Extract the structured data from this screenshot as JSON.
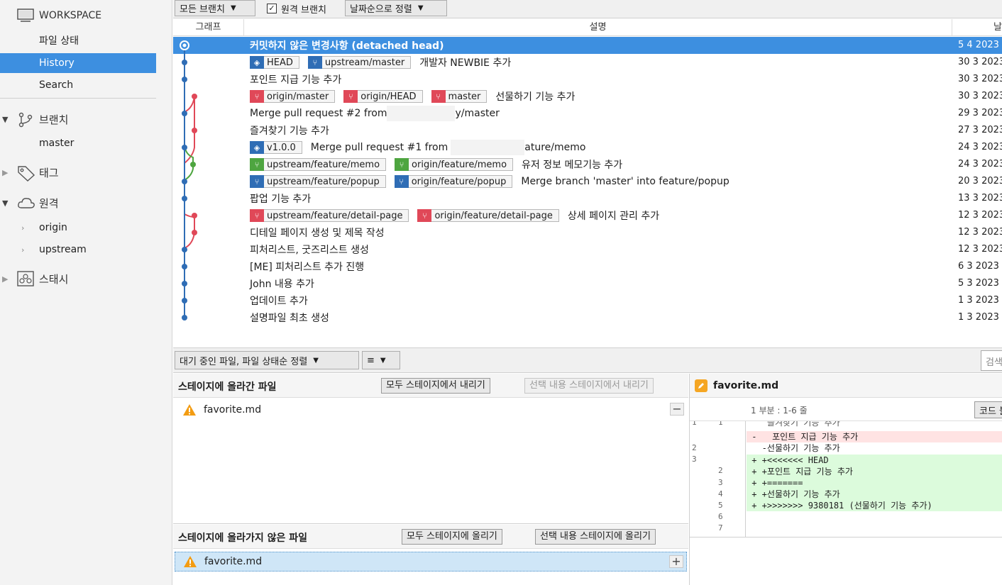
{
  "sidebar": {
    "workspace_label": "WORKSPACE",
    "workspace_items": [
      "파일 상태",
      "History",
      "Search"
    ],
    "branches_label": "브랜치",
    "branches": [
      "master"
    ],
    "tags_label": "태그",
    "remotes_label": "원격",
    "remotes": [
      "origin",
      "upstream"
    ],
    "stash_label": "스태시"
  },
  "toolbar": {
    "branch_filter": "모든 브랜치",
    "remote_branches_label": "원격 브랜치",
    "remote_branches_checked": true,
    "sort_label": "날짜순으로 정렬"
  },
  "table": {
    "col_graph": "그래프",
    "col_desc": "설명",
    "col_date": "날",
    "rows": [
      {
        "desc": "커밋하지 않은 변경사항 (detached head)",
        "date": "5 4 2023"
      },
      {
        "desc": "개발자 NEWBIE 추가",
        "date": "30 3 2023"
      },
      {
        "desc": "포인트 지급 기능 추가",
        "date": "30 3 2023"
      },
      {
        "desc": "선물하기 기능 추가",
        "date": "30 3 2023"
      },
      {
        "desc_a": "Merge pull request #2 from",
        "desc_b": "y/master",
        "date": "29 3 2023"
      },
      {
        "desc": "즐겨찾기 기능 추가",
        "date": "27 3 2023"
      },
      {
        "desc_a": "Merge pull request #1 from",
        "desc_b": "ature/memo",
        "date": "24 3 2023"
      },
      {
        "desc": "유저 정보 메모기능 추가",
        "date": "24 3 2023"
      },
      {
        "desc": "Merge branch 'master' into feature/popup",
        "date": "20 3 2023"
      },
      {
        "desc": "팝업 기능 추가",
        "date": "13 3 2023"
      },
      {
        "desc": "상세 페이지 관리 추가",
        "date": "12 3 2023"
      },
      {
        "desc": "디테일 페이지 생성 및 제목 작성",
        "date": "12 3 2023"
      },
      {
        "desc": "피처리스트, 굿즈리스트 생성",
        "date": "12 3 2023"
      },
      {
        "desc": "[ME] 피처리스트 추가 진행",
        "date": "6 3 2023"
      },
      {
        "desc": "John 내용 추가",
        "date": "5 3 2023"
      },
      {
        "desc": "업데이트 추가",
        "date": "1 3 2023"
      },
      {
        "desc": "설명파일 최초 생성",
        "date": "1 3 2023"
      }
    ],
    "tags": {
      "r1": [
        "HEAD",
        "upstream/master"
      ],
      "r3": [
        "origin/master",
        "origin/HEAD",
        "master"
      ],
      "r6": [
        "v1.0.0"
      ],
      "r7": [
        "upstream/feature/memo",
        "origin/feature/memo"
      ],
      "r8": [
        "upstream/feature/popup",
        "origin/feature/popup"
      ],
      "r10": [
        "upstream/feature/detail-page",
        "origin/feature/detail-page"
      ]
    }
  },
  "lower_toolbar": {
    "sort_label": "대기 중인 파일, 파일 상태순 정렬",
    "view_icon": "≡",
    "search_placeholder": "검색"
  },
  "staged": {
    "title": "스테이지에 올라간 파일",
    "btn_unstage_all": "모두 스테이지에서 내리기",
    "btn_unstage_selected": "선택 내용 스테이지에서 내리기",
    "files": [
      "favorite.md"
    ]
  },
  "unstaged": {
    "title": "스테이지에 올라가지 않은 파일",
    "btn_stage_all": "모두 스테이지에 올리기",
    "btn_stage_selected": "선택 내용 스테이지에 올리기",
    "files": [
      "favorite.md"
    ]
  },
  "diff": {
    "filename": "favorite.md",
    "hunk_label": "1 부분 : 1-6 줄",
    "hunk_button": "코드 블록",
    "lines": [
      {
        "old": "1",
        "new": "1",
        "type": "ctx",
        "text": "    즐겨찾기 기능 추가"
      },
      {
        "old": "2",
        "new": "",
        "type": "del",
        "text": " -   포인트 지급 기능 추가"
      },
      {
        "old": "3",
        "new": "2",
        "type": "ctx",
        "text": "   -선물하기 기능 추가"
      },
      {
        "old": "",
        "new": "3",
        "type": "add",
        "text": " + +<<<<<<< HEAD"
      },
      {
        "old": "",
        "new": "4",
        "type": "add",
        "text": " + +포인트 지급 기능 추가"
      },
      {
        "old": "",
        "new": "5",
        "type": "add",
        "text": " + +======="
      },
      {
        "old": "",
        "new": "6",
        "type": "add",
        "text": " + +선물하기 기능 추가"
      },
      {
        "old": "",
        "new": "7",
        "type": "add",
        "text": " + +>>>>>>> 9380181 (선물하기 기능 추가)"
      }
    ]
  },
  "colors": {
    "selection": "#3d8fe0",
    "graph_blue": "#2f6db5",
    "graph_red": "#e04858",
    "graph_green": "#4ea540"
  }
}
